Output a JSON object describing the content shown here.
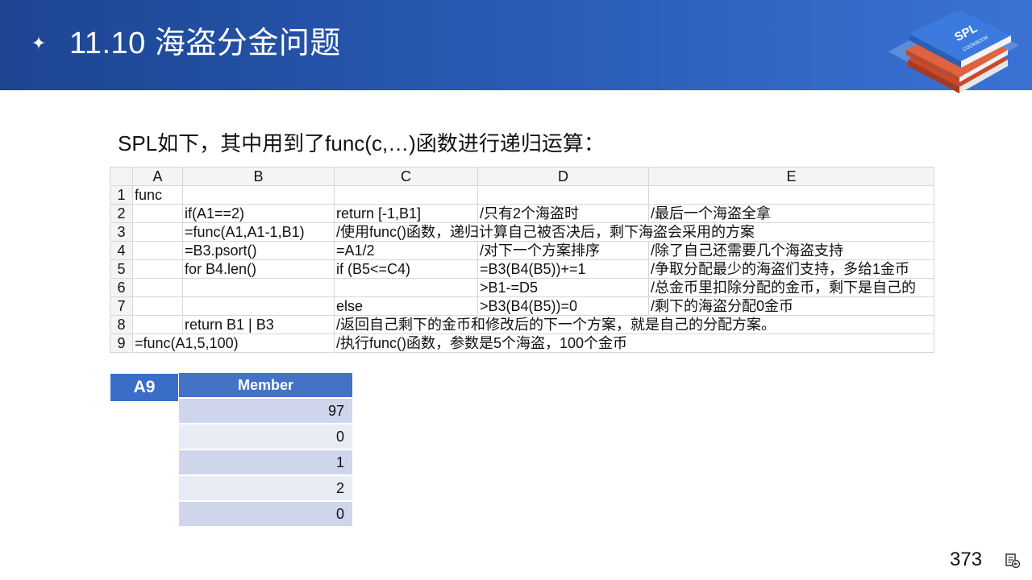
{
  "header": {
    "title": "11.10 海盗分金问题",
    "star": "✦"
  },
  "intro": "SPL如下，其中用到了func(c,…)函数进行递归运算：",
  "grid": {
    "columns": [
      "A",
      "B",
      "C",
      "D",
      "E"
    ],
    "rows": [
      {
        "n": "1",
        "A": "func",
        "B": "",
        "C": "",
        "D": "",
        "E": ""
      },
      {
        "n": "2",
        "A": "",
        "B": "if(A1==2)",
        "C": "return [-1,B1]",
        "D": "/只有2个海盗时",
        "E": "/最后一个海盗全拿"
      },
      {
        "n": "3",
        "A": "",
        "B": "=func(A1,A1-1,B1)",
        "C": "/使用func()函数，递归计算自己被否决后，剩下海盗会采用的方案",
        "D": "",
        "E": ""
      },
      {
        "n": "4",
        "A": "",
        "B": "=B3.psort()",
        "C": "=A1/2",
        "D": "/对下一个方案排序",
        "E": "/除了自己还需要几个海盗支持"
      },
      {
        "n": "5",
        "A": "",
        "B": "for B4.len()",
        "C": "if (B5<=C4)",
        "D": "=B3(B4(B5))+=1",
        "E": "/争取分配最少的海盗们支持，多给1金币"
      },
      {
        "n": "6",
        "A": "",
        "B": "",
        "C": "",
        "D": ">B1-=D5",
        "E": "/总金币里扣除分配的金币，剩下是自己的"
      },
      {
        "n": "7",
        "A": "",
        "B": "",
        "C": "else",
        "D": ">B3(B4(B5))=0",
        "E": "/剩下的海盗分配0金币"
      },
      {
        "n": "8",
        "A": "",
        "B": "return B1 | B3",
        "C": "/返回自己剩下的金币和修改后的下一个方案，就是自己的分配方案。",
        "D": "",
        "E": ""
      },
      {
        "n": "9",
        "A": "=func(A1,5,100)",
        "B": "",
        "C": "/执行func()函数，参数是5个海盗，100个金币",
        "D": "",
        "E": ""
      }
    ]
  },
  "result": {
    "label": "A9",
    "header": "Member",
    "values": [
      "97",
      "0",
      "1",
      "2",
      "0"
    ]
  },
  "logo": {
    "text": "SPL",
    "subtext": "COOKBOOK"
  },
  "page_number": "373",
  "colors": {
    "header_start": "#1d4592",
    "header_end": "#3a73d4",
    "accent": "#4472c4"
  }
}
